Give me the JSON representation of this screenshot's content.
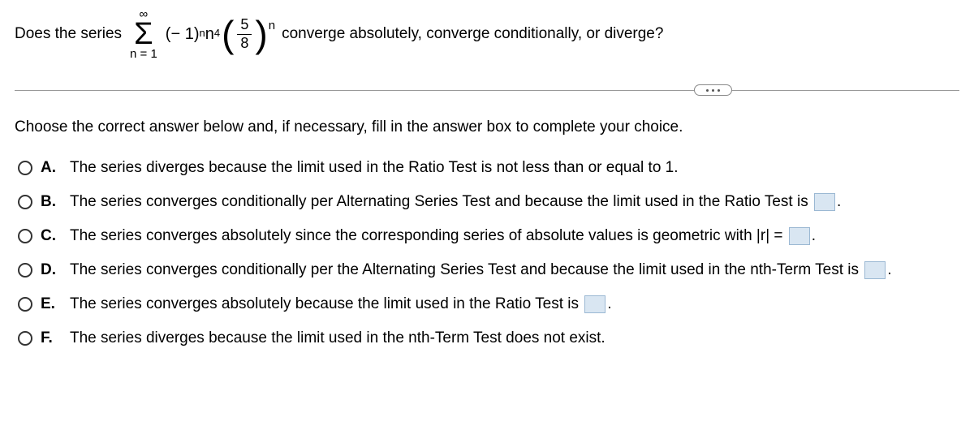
{
  "question": {
    "before": "Does the series",
    "sigma_top": "∞",
    "sigma_bottom": "n = 1",
    "term_base": "(− 1)",
    "term_exp1": "n",
    "term_n": "n",
    "term_exp2": "4",
    "frac_num": "5",
    "frac_den": "8",
    "outer_exp": "n",
    "after": "converge absolutely, converge conditionally, or diverge?"
  },
  "instruction": "Choose the correct answer below and, if necessary, fill in the answer box to complete your choice.",
  "choices": {
    "a": {
      "label": "A.",
      "text": "The series diverges because the limit used in the Ratio Test is not less than or equal to 1."
    },
    "b": {
      "label": "B.",
      "text_before": "The series converges conditionally per Alternating Series Test and because the limit used in the Ratio Test is ",
      "text_after": "."
    },
    "c": {
      "label": "C.",
      "text_before": "The series converges absolutely since the corresponding series of absolute values is geometric with |r| = ",
      "text_after": "."
    },
    "d": {
      "label": "D.",
      "text_before": "The series converges conditionally per the Alternating Series Test and because the limit used in the nth-Term Test is ",
      "text_after": "."
    },
    "e": {
      "label": "E.",
      "text_before": "The series converges absolutely because the limit used in the Ratio Test is ",
      "text_after": "."
    },
    "f": {
      "label": "F.",
      "text": "The series diverges because the limit used in the nth-Term Test does not exist."
    }
  }
}
